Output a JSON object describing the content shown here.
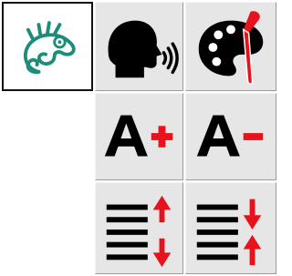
{
  "toolbar": {
    "buttons": [
      {
        "id": "mascot",
        "icon": "chameleon-icon",
        "tooltip": ""
      },
      {
        "id": "text-to-speech",
        "icon": "speaking-head-icon"
      },
      {
        "id": "color-theme",
        "icon": "palette-brush-icon"
      },
      {
        "id": "increase-font-size",
        "icon": "font-increase-icon"
      },
      {
        "id": "decrease-font-size",
        "icon": "font-decrease-icon"
      },
      {
        "id": "increase-line-spacing",
        "icon": "line-spacing-increase-icon"
      },
      {
        "id": "decrease-line-spacing",
        "icon": "line-spacing-decrease-icon"
      }
    ],
    "selected": "mascot"
  },
  "colors": {
    "tile_bg": "#e6e6e6",
    "icon_black": "#000000",
    "accent_red": "#e8121c",
    "mascot_teal": "#1d8c7a"
  }
}
